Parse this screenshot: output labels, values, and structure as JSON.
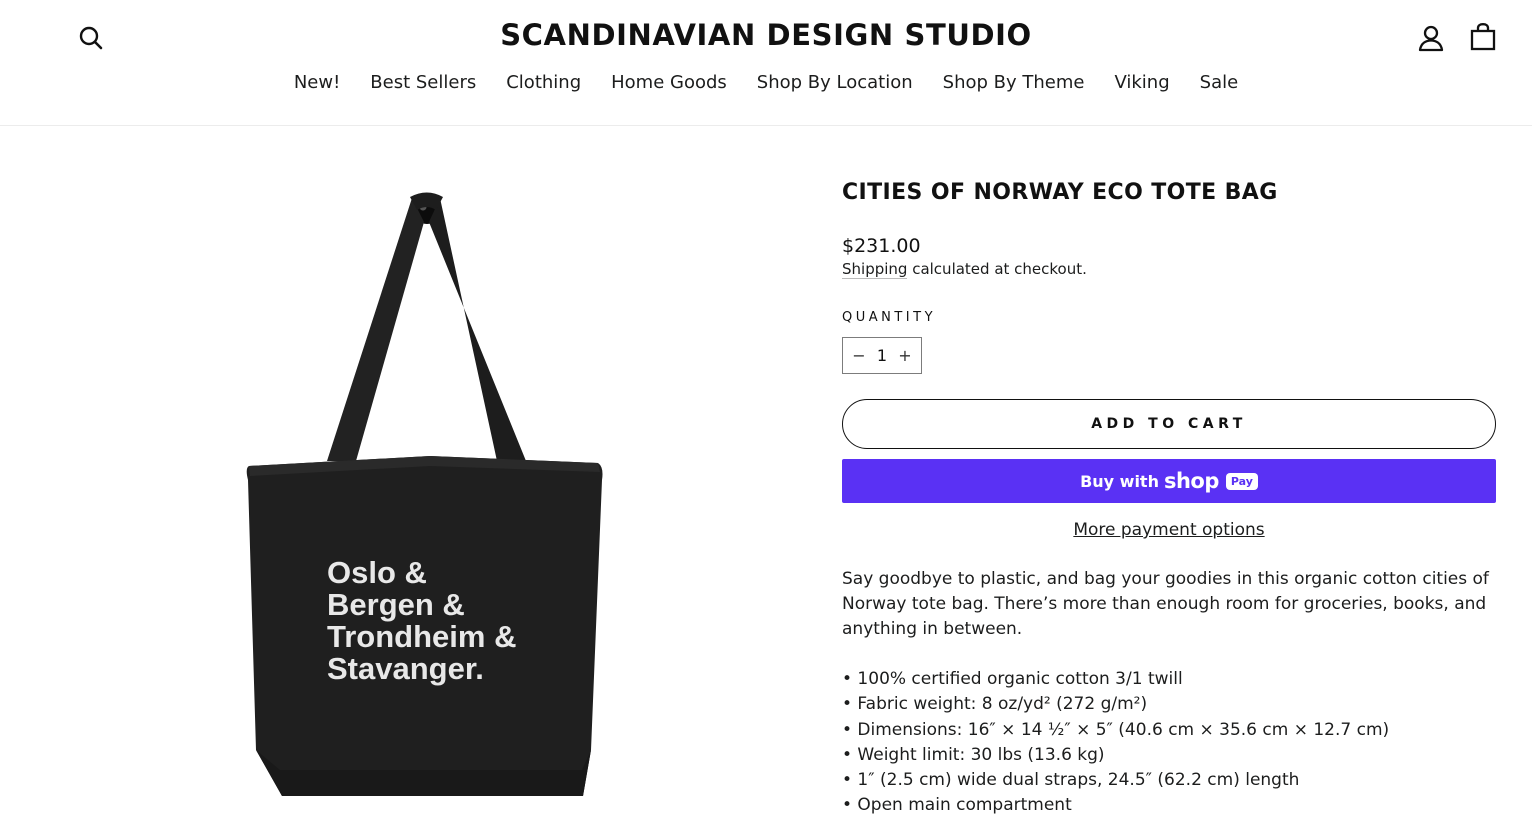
{
  "header": {
    "store_name": "SCANDINAVIAN DESIGN STUDIO",
    "nav": [
      "New!",
      "Best Sellers",
      "Clothing",
      "Home Goods",
      "Shop By Location",
      "Shop By Theme",
      "Viking",
      "Sale"
    ]
  },
  "product": {
    "title": "CITIES OF NORWAY ECO TOTE BAG",
    "price": "$231.00",
    "shipping_link": "Shipping",
    "shipping_text": " calculated at checkout.",
    "quantity_label": "QUANTITY",
    "quantity_minus": "−",
    "quantity_value": "1",
    "quantity_plus": "+",
    "add_to_cart": "ADD TO CART",
    "shop_pay_buy_with": "Buy with",
    "shop_pay_shop": "shop",
    "shop_pay_badge": "Pay",
    "more_payment_options": "More payment options",
    "description": "Say goodbye to plastic, and bag your goodies in this organic cotton cities of Norway tote bag. There’s more than enough room for groceries, books, and anything in between.",
    "bullets": [
      "• 100% certified organic cotton 3/1 twill",
      "• Fabric weight: 8 oz/yd² (272 g/m²)",
      "• Dimensions: 16″ × 14 ½″ × 5″ (40.6 cm × 35.6 cm × 12.7 cm)",
      "• Weight limit: 30 lbs (13.6 kg)",
      "• 1″ (2.5 cm) wide dual straps, 24.5″ (62.2 cm) length",
      "• Open main compartment"
    ],
    "bag_text": [
      "Oslo &",
      "Bergen &",
      "Trondheim &",
      "Stavanger."
    ]
  },
  "colors": {
    "shop_pay": "#5a31f4",
    "bag": "#1f1f1f",
    "text": "#1c1d1d"
  }
}
